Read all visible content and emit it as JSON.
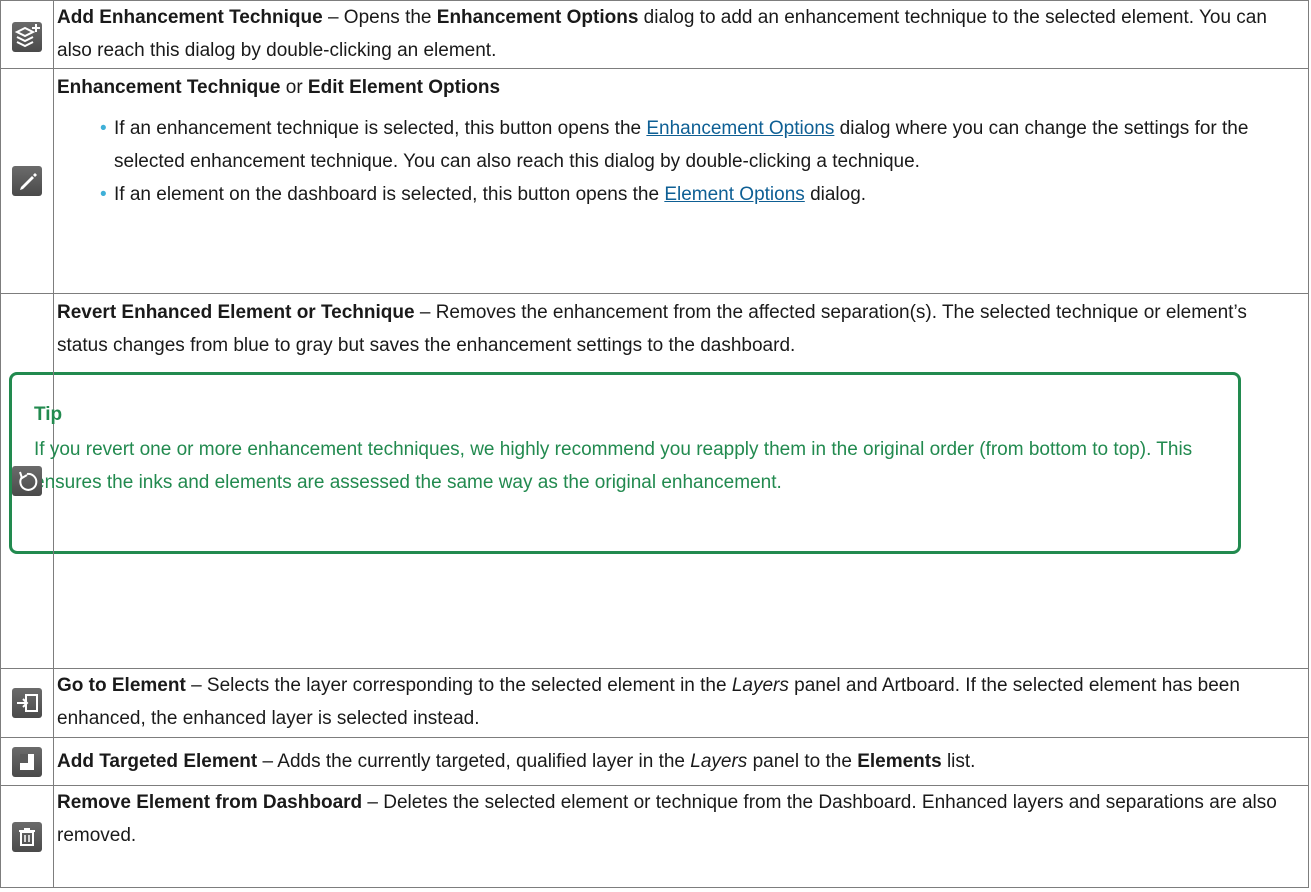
{
  "rows": [
    {
      "icon": "add-layers-icon",
      "title": "Add Enhancement Technique",
      "sep": " – Opens the ",
      "bold2": "Enhancement Options",
      "rest": " dialog to add an enhancement technique to the selected element. You can also reach this dialog by double-clicking an element."
    },
    {
      "icon": "pencil-icon",
      "title": "Enhancement Technique",
      "or": " or ",
      "title2": "Edit Element Options",
      "bullet1_pre": "If an enhancement technique is selected, this button opens the ",
      "bullet1_link": "Enhancement Options",
      "bullet1_post": " dialog where you can change the settings for the selected enhancement technique. You can also reach this dialog by double-clicking a technique.",
      "bullet2_pre": "If an element on the dashboard is selected, this button opens the ",
      "bullet2_link": "Element Options",
      "bullet2_post": " dialog."
    },
    {
      "icon": "revert-icon",
      "title": "Revert Enhanced Element or Technique",
      "rest": " – Removes the enhancement from the affected separation(s). The selected technique or element’s status changes from blue to gray but saves the enhancement settings to the dashboard.",
      "tip_title": "Tip",
      "tip_body": "If you revert one or more enhancement techniques, we highly recommend you reapply them in the original order (from bottom to top). This ensures the inks and elements are assessed the same way as the original enhancement."
    },
    {
      "icon": "go-to-element-icon",
      "title": "Go to Element",
      "pre": " – Selects the layer corresponding to the selected element in the ",
      "italic": "Layers",
      "post": " panel and Artboard. If the selected element has been enhanced, the enhanced layer is selected instead."
    },
    {
      "icon": "add-targeted-element-icon",
      "title": "Add Targeted Element",
      "pre": " – Adds the currently targeted, qualified layer in the ",
      "italic": "Layers",
      "mid": " panel to the ",
      "bold2": "Elements",
      "post": " list."
    },
    {
      "icon": "trash-icon",
      "title": "Remove Element from Dashboard",
      "rest": " – Deletes the selected element or technique from the Dashboard. Enhanced layers and separations are also removed."
    }
  ]
}
